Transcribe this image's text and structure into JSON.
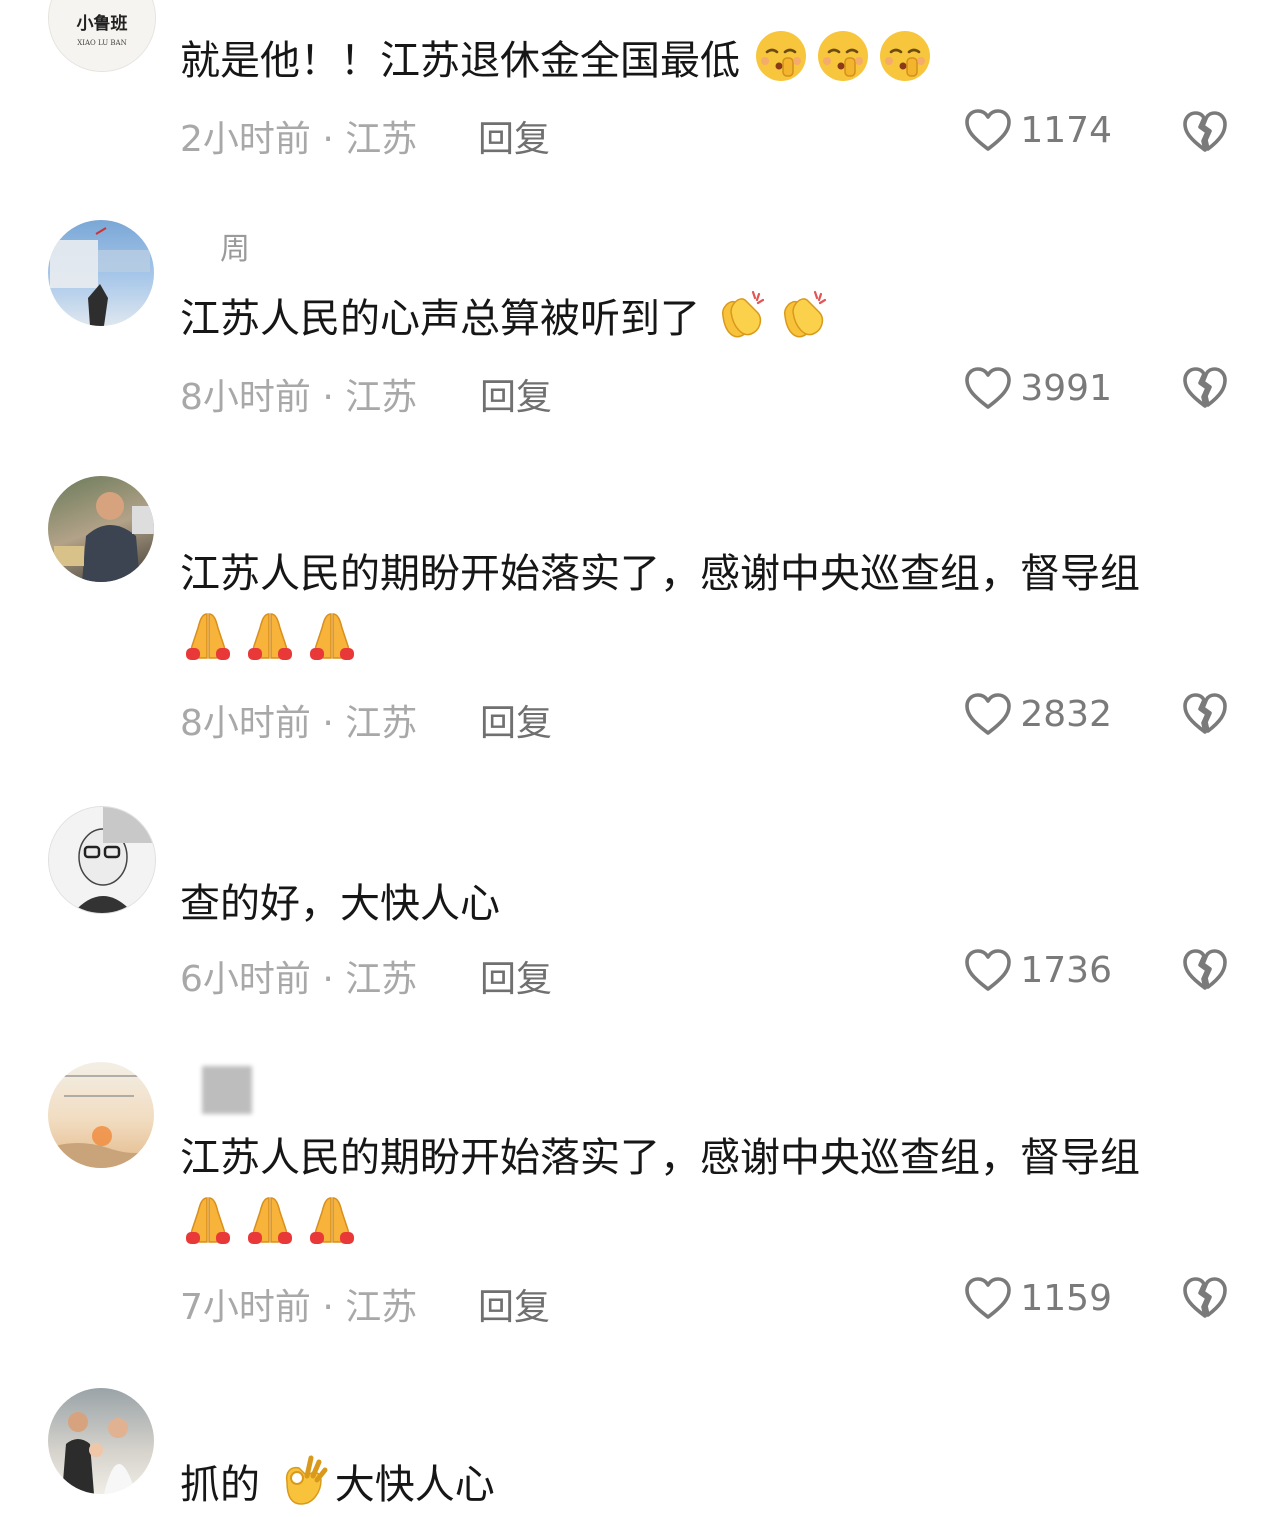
{
  "comments": [
    {
      "username": "",
      "text": "就是他！！江苏退休金全国最低",
      "emojis": [
        "shush-emoji",
        "shush-emoji",
        "shush-emoji"
      ],
      "time": "2小时前",
      "location": "江苏",
      "reply": "回复",
      "likes": "1174"
    },
    {
      "username": "周",
      "text": "江苏人民的心声总算被听到了",
      "emojis": [
        "clap-emoji",
        "clap-emoji"
      ],
      "time": "8小时前",
      "location": "江苏",
      "reply": "回复",
      "likes": "3991"
    },
    {
      "username": "",
      "text": "江苏人民的期盼开始落实了，感谢中央巡查组，督导组",
      "emojis": [
        "pray-emoji",
        "pray-emoji",
        "pray-emoji"
      ],
      "time": "8小时前",
      "location": "江苏",
      "reply": "回复",
      "likes": "2832"
    },
    {
      "username": "",
      "text": "查的好，大快人心",
      "emojis": [],
      "time": "6小时前",
      "location": "江苏",
      "reply": "回复",
      "likes": "1736"
    },
    {
      "username": "",
      "text": "江苏人民的期盼开始落实了，感谢中央巡查组，督导组",
      "emojis": [
        "pray-emoji",
        "pray-emoji",
        "pray-emoji"
      ],
      "time": "7小时前",
      "location": "江苏",
      "reply": "回复",
      "likes": "1159"
    },
    {
      "username": "",
      "text_before": "抓的",
      "text_after": "大快人心",
      "emojis": [
        "ok-hand-emoji"
      ]
    }
  ],
  "avatar_logo": {
    "line1": "小鲁班",
    "line2": "XIAO LU BAN"
  },
  "separator": "·",
  "colors": {
    "text": "#161616",
    "meta": "#a8a8a8",
    "icon": "#7a7a7a"
  }
}
